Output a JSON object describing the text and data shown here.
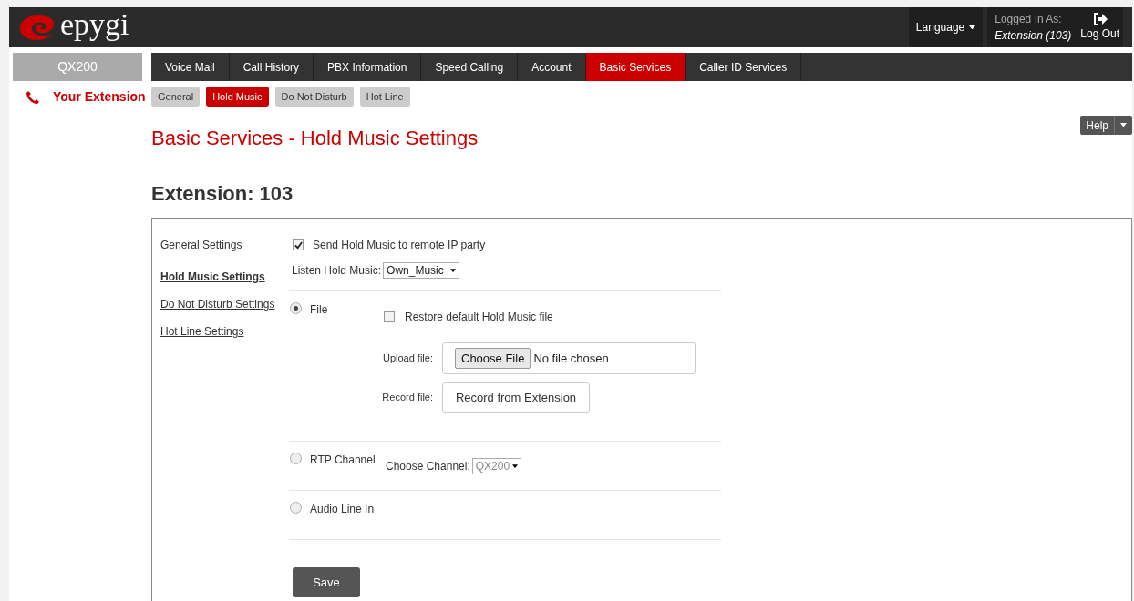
{
  "header": {
    "logo": "epygi",
    "language": "Language",
    "logged_in_label": "Logged In As:",
    "logged_in_user": "Extension (103)",
    "logout": "Log Out"
  },
  "device": "QX200",
  "your_extension": "Your Extension",
  "main_tabs": [
    {
      "label": "Voice Mail",
      "selected": false
    },
    {
      "label": "Call History",
      "selected": false
    },
    {
      "label": "PBX Information",
      "selected": false
    },
    {
      "label": "Speed Calling",
      "selected": false
    },
    {
      "label": "Account",
      "selected": false
    },
    {
      "label": "Basic Services",
      "selected": true
    },
    {
      "label": "Caller ID Services",
      "selected": false
    }
  ],
  "sub_tabs": [
    {
      "label": "General",
      "selected": false
    },
    {
      "label": "Hold Music",
      "selected": true
    },
    {
      "label": "Do Not Disturb",
      "selected": false
    },
    {
      "label": "Hot Line",
      "selected": false
    }
  ],
  "page_title": "Basic Services - Hold Music Settings",
  "help": "Help",
  "extension_title": "Extension: 103",
  "side_links": [
    {
      "label": "General Settings",
      "selected": false
    },
    {
      "label": "Hold Music Settings",
      "selected": true
    },
    {
      "label": "Do Not Disturb Settings",
      "selected": false
    },
    {
      "label": "Hot Line Settings",
      "selected": false
    }
  ],
  "send_hold_music": {
    "label": "Send Hold Music to remote IP party",
    "checked": true
  },
  "listen_hold_music": {
    "label": "Listen Hold Music:",
    "value": "Own_Music"
  },
  "sources": [
    {
      "kind": "file",
      "label": "File",
      "selected": true,
      "restore": {
        "label": "Restore default Hold Music file",
        "checked": false
      },
      "upload_label": "Upload file:",
      "choose_button": "Choose File",
      "no_file": "No file chosen",
      "record_label": "Record file:",
      "record_button": "Record from Extension"
    },
    {
      "kind": "channel",
      "label": "RTP Channel",
      "selected": false,
      "channel_label": "Choose Channel:",
      "channel_value": "QX200"
    },
    {
      "kind": "plain",
      "label": "Audio Line In",
      "selected": false
    }
  ],
  "save": "Save"
}
